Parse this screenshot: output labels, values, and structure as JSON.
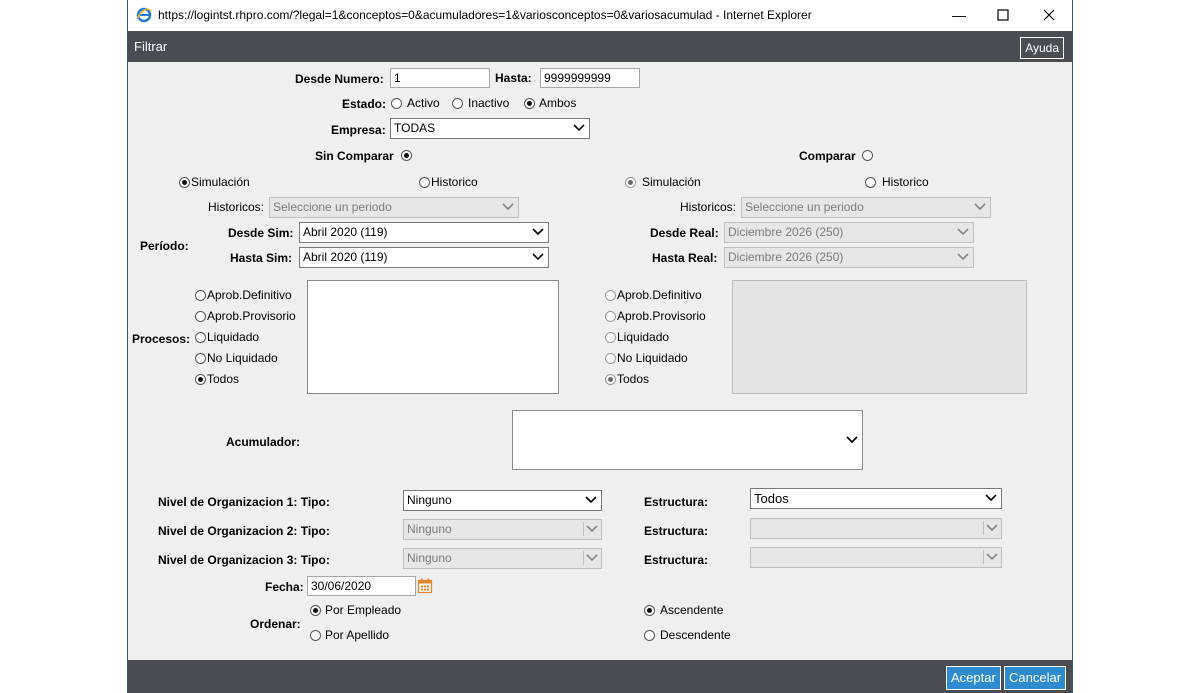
{
  "window": {
    "url": "https://logintst.rhpro.com/?legal=1&conceptos=0&acumuladores=1&variosconceptos=0&variosacumulad - Internet Explorer"
  },
  "header": {
    "title": "Filtrar",
    "help_label": "Ayuda"
  },
  "form": {
    "desde_numero_label": "Desde Numero:",
    "desde_numero_value": "1",
    "hasta_label": "Hasta:",
    "hasta_value": "9999999999",
    "estado_label": "Estado:",
    "estado_options": [
      "Activo",
      "Inactivo",
      "Ambos"
    ],
    "empresa_label": "Empresa:",
    "empresa_value": "TODAS",
    "sin_comparar_label": "Sin Comparar",
    "comparar_label": "Comparar",
    "left": {
      "simulacion_label": "Simulación",
      "historico_label": "Historico",
      "historicos_label": "Historicos:",
      "historicos_placeholder": "Seleccione un periodo",
      "desde_label": "Desde Sim:",
      "desde_value": "Abril 2020 (119)",
      "hasta_label": "Hasta Sim:",
      "hasta_value": "Abril 2020 (119)"
    },
    "right": {
      "simulacion_label": "Simulación",
      "historico_label": "Historico",
      "historicos_label": "Historicos:",
      "historicos_placeholder": "Seleccione un periodo",
      "desde_label": "Desde Real:",
      "desde_value": "Diciembre 2026 (250)",
      "hasta_label": "Hasta Real:",
      "hasta_value": "Diciembre 2026 (250)"
    },
    "periodo_label": "Período:",
    "procesos_label": "Procesos:",
    "procesos_options": [
      "Aprob.Definitivo",
      "Aprob.Provisorio",
      "Liquidado",
      "No Liquidado",
      "Todos"
    ],
    "acumulador_label": "Acumulador:",
    "nivel1_label": "Nivel de Organizacion 1: Tipo:",
    "nivel1_value": "Ninguno",
    "nivel2_label": "Nivel de Organizacion 2: Tipo:",
    "nivel2_value": "Ninguno",
    "nivel3_label": "Nivel de Organizacion 3: Tipo:",
    "nivel3_value": "Ninguno",
    "estructura_label": "Estructura:",
    "estructura1_value": "Todos",
    "fecha_label": "Fecha:",
    "fecha_value": "30/06/2020",
    "ordenar_label": "Ordenar:",
    "ordenar_options": [
      "Por Empleado",
      "Por Apellido"
    ],
    "orden_options": [
      "Ascendente",
      "Descendente"
    ]
  },
  "footer": {
    "accept_label": "Aceptar",
    "cancel_label": "Cancelar"
  },
  "colors": {
    "header_bg": "#4a4c52",
    "content_bg": "#efefef",
    "button_blue": "#2f8bd0"
  },
  "icons": [
    "ie-logo-icon",
    "minimize-icon",
    "maximize-icon",
    "close-icon",
    "chevron-down-icon",
    "calendar-icon"
  ]
}
